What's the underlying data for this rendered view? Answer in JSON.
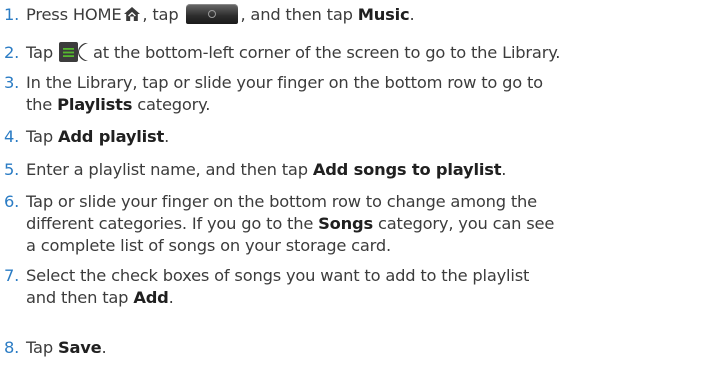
{
  "steps": [
    {
      "num": "1.",
      "t1": "Press HOME",
      "t2": ", tap",
      "t3": ", and then tap",
      "kw": "Music",
      "t4": "."
    },
    {
      "num": "2.",
      "t1": "Tap",
      "t2": "at the bottom-left corner of the screen to go to the Library."
    },
    {
      "num": "3.",
      "l1": "In the Library, tap or slide your finger on the bottom row to go to",
      "l2a": "the",
      "kw": "Playlists",
      "l2b": "category."
    },
    {
      "num": "4.",
      "t1": "Tap",
      "kw": "Add playlist",
      "t2": "."
    },
    {
      "num": "5.",
      "t1": "Enter a playlist name, and then tap",
      "kw": "Add songs to playlist",
      "t2": "."
    },
    {
      "num": "6.",
      "l1": "Tap or slide your finger on the bottom row to change among the",
      "l2a": "different categories. If you go to the",
      "kw": "Songs",
      "l2b": "category, you can see",
      "l3": "a complete list of songs on your storage card."
    },
    {
      "num": "7.",
      "l1": "Select the check boxes of songs you want to add to the playlist",
      "l2a": "and then tap",
      "kw": "Add",
      "l2b": "."
    },
    {
      "num": "8.",
      "t1": "Tap",
      "kw": "Save",
      "t2": "."
    }
  ],
  "icons": {
    "home": "home-icon",
    "launcher": "launcher-tab-icon",
    "library": "library-menu-icon"
  }
}
